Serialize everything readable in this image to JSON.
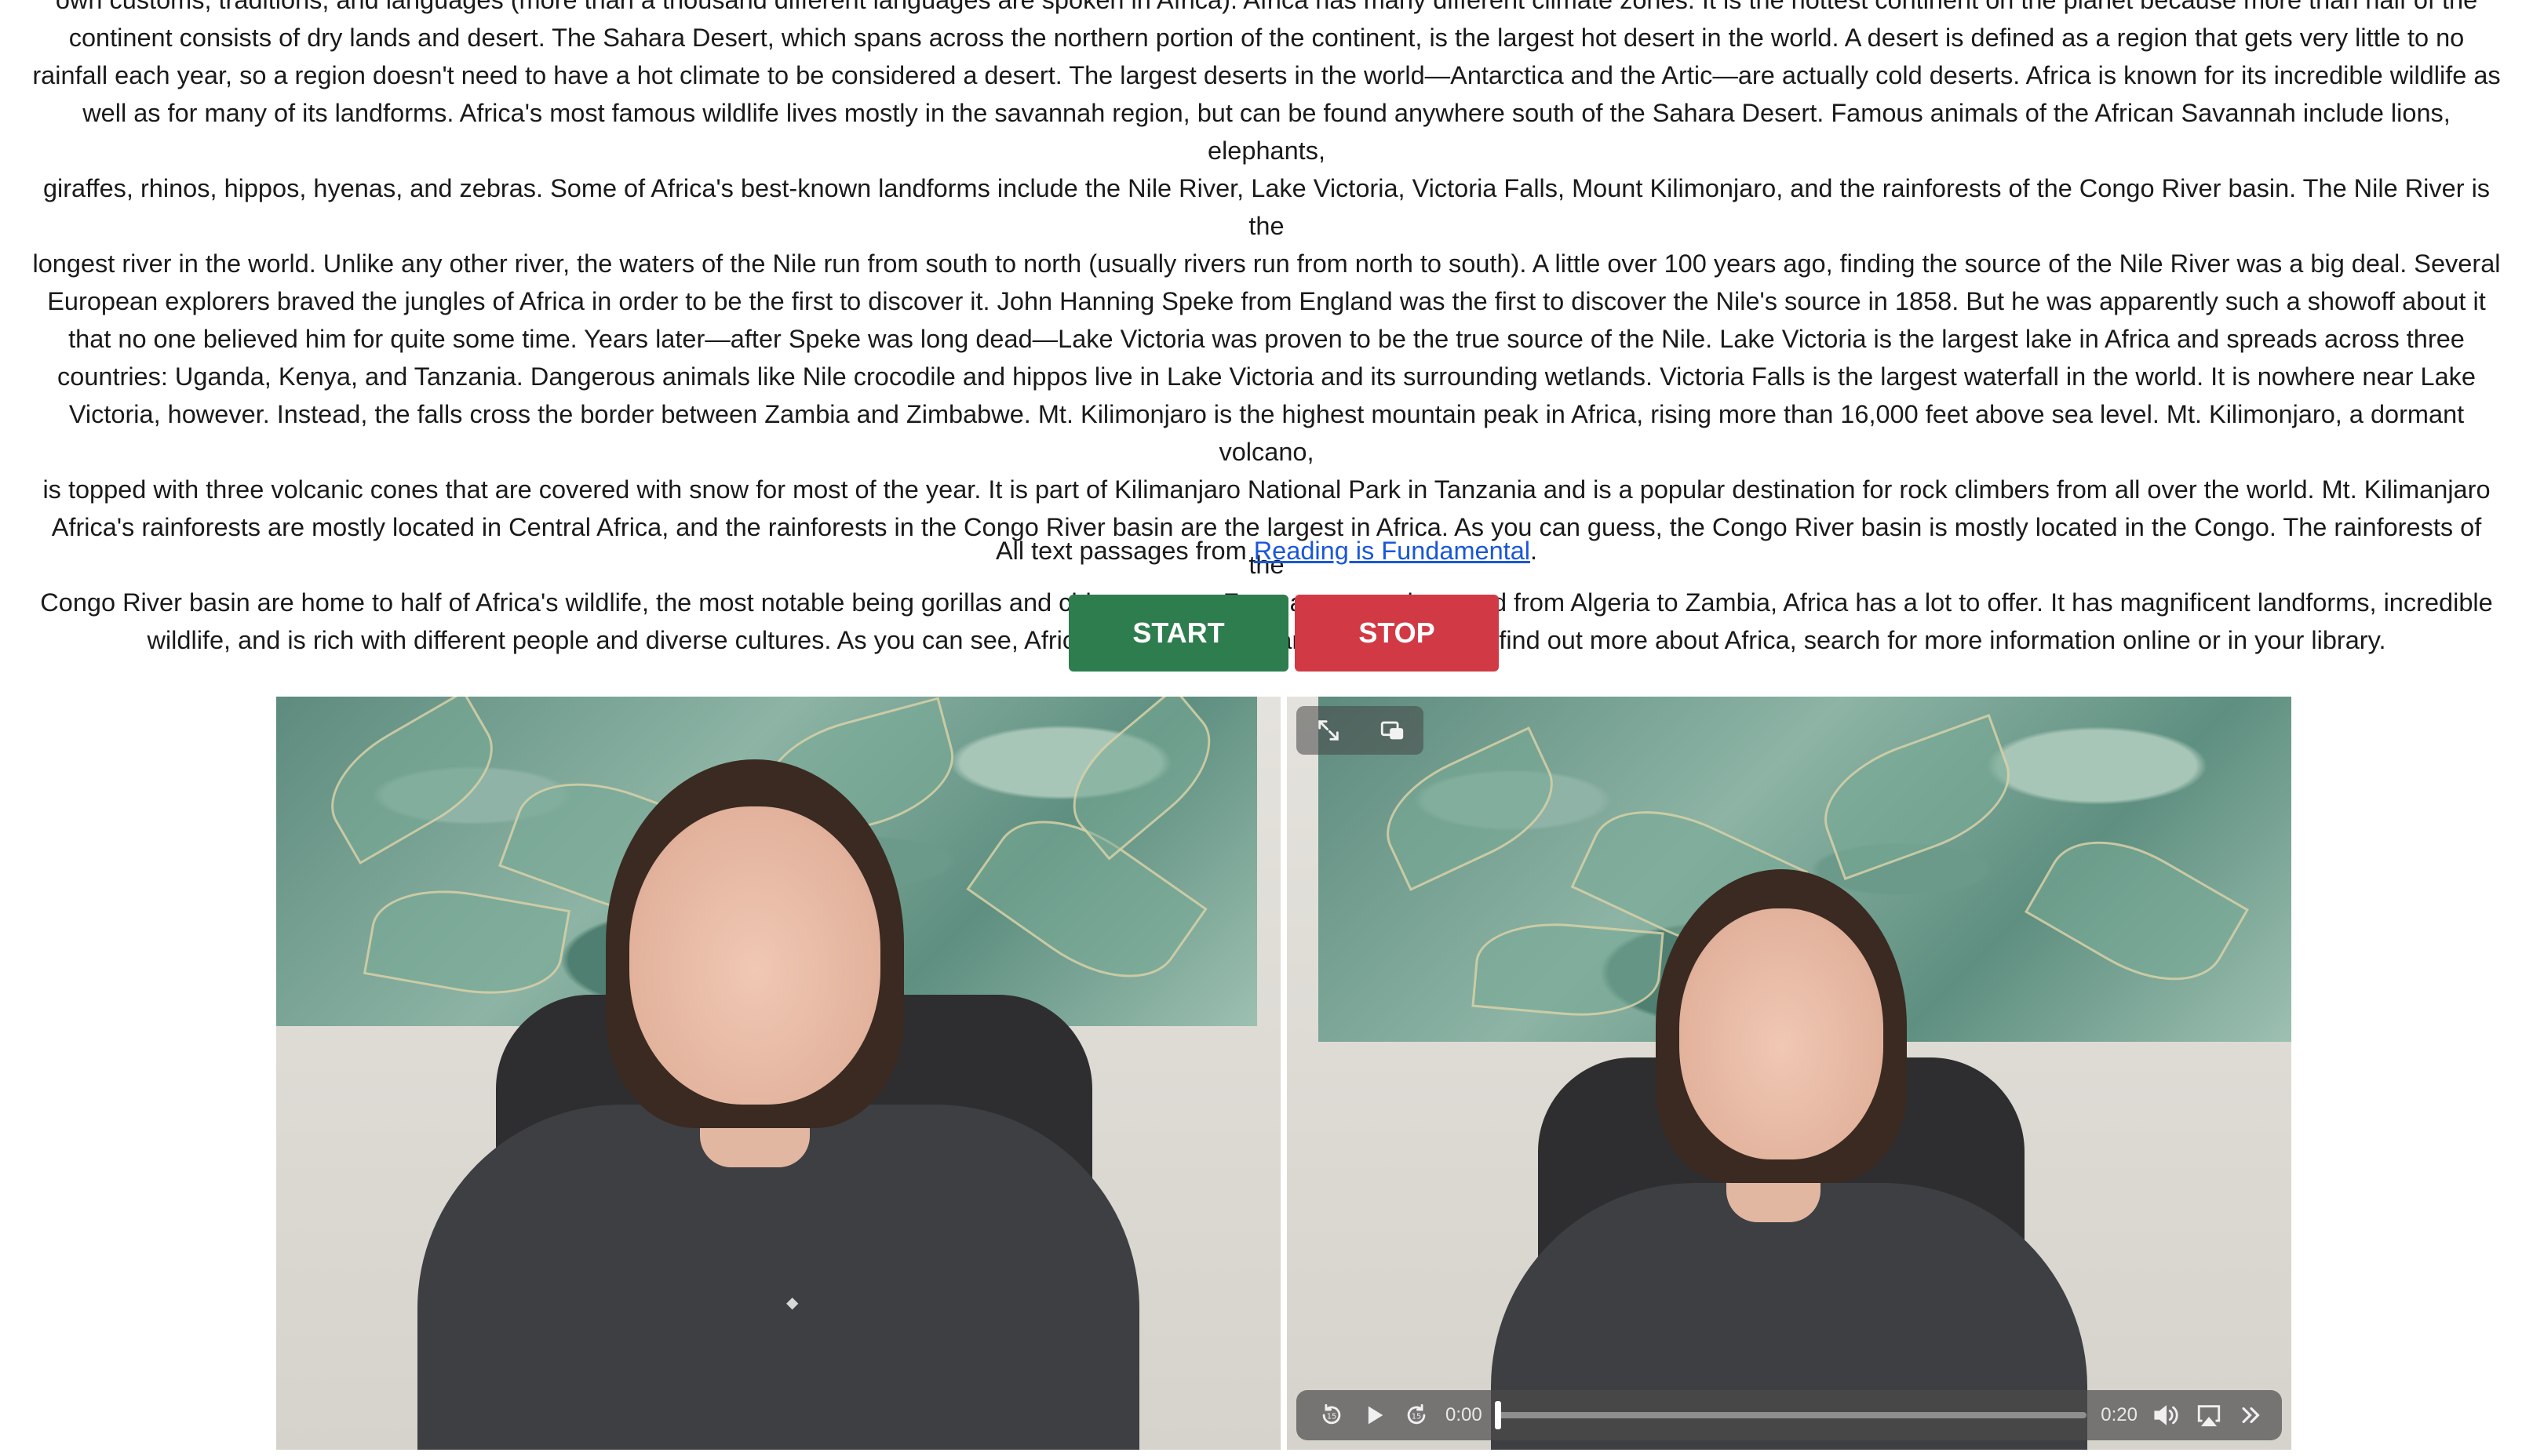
{
  "passage": {
    "lines": [
      "own customs, traditions, and languages (more than a thousand different languages are spoken in Africa). Africa has many different climate zones. It is the hottest continent on the planet because more than half of the",
      "continent consists of dry lands and desert. The Sahara Desert, which spans across the northern portion of the continent, is the largest hot desert in the world. A desert is defined as a region that gets very little to no",
      "rainfall each year, so a region doesn't need to have a hot climate to be considered a desert. The largest deserts in the world—Antarctica and the Artic—are actually cold deserts. Africa is known for its incredible wildlife as",
      "well as for many of its landforms. Africa's most famous wildlife lives mostly in the savannah region, but can be found anywhere south of the Sahara Desert. Famous animals of the African Savannah include lions, elephants,",
      "giraffes, rhinos, hippos, hyenas, and zebras. Some of Africa's best-known landforms include the Nile River, Lake Victoria, Victoria Falls, Mount Kilimonjaro, and the rainforests of the Congo River basin. The Nile River is the",
      "longest river in the world. Unlike any other river, the waters of the Nile run from south to north (usually rivers run from north to south). A little over 100 years ago, finding the source of the Nile River was a big deal. Several",
      "European explorers braved the jungles of Africa in order to be the first to discover it. John Hanning Speke from England was the first to discover the Nile's source in 1858. But he was apparently such a showoff about it",
      "that no one believed him for quite some time. Years later—after Speke was long dead—Lake Victoria was proven to be the true source of the Nile. Lake Victoria is the largest lake in Africa and spreads across three",
      "countries: Uganda, Kenya, and Tanzania. Dangerous animals like Nile crocodile and hippos live in Lake Victoria and its surrounding wetlands. Victoria Falls is the largest waterfall in the world. It is nowhere near Lake",
      "Victoria, however. Instead, the falls cross the border between Zambia and Zimbabwe. Mt. Kilimonjaro is the highest mountain peak in Africa, rising more than 16,000 feet above sea level. Mt. Kilimonjaro, a dormant volcano,",
      "is topped with three volcanic cones that are covered with snow for most of the year. It is part of Kilimanjaro National Park in Tanzania and is a popular destination for rock climbers from all over the world. Mt. Kilimanjaro",
      "Africa's rainforests are mostly located in Central Africa, and the rainforests in the Congo River basin are the largest in Africa. As you can guess, the Congo River basin is mostly located in the Congo. The rainforests of the",
      "Congo River basin are home to half of Africa's wildlife, the most notable being gorillas and chimpanzees. From apes to zebras and from Algeria to Zambia, Africa has a lot to offer. It has magnificent landforms, incredible",
      "wildlife, and is rich with different people and diverse cultures. As you can see, Africa is worth more than just a glance; to find out more about Africa, search for more information online or in your library."
    ]
  },
  "attribution": {
    "prefix": "All text passages from ",
    "link_text": "Reading is Fundamental",
    "suffix": "."
  },
  "buttons": {
    "start_label": "START",
    "stop_label": "STOP",
    "start_color": "#2e7d4f",
    "stop_color": "#d13a45"
  },
  "videos": {
    "left": {
      "description_icon": "webcam-feed"
    },
    "right": {
      "top_controls": [
        "fullscreen-icon",
        "picture-in-picture-icon"
      ],
      "current_time": "0:00",
      "duration": "0:20",
      "progress_fraction": 0.0,
      "controls": [
        "skip-back-15-icon",
        "play-icon",
        "skip-forward-15-icon",
        "volume-icon",
        "airplay-icon",
        "more-icon"
      ]
    }
  }
}
